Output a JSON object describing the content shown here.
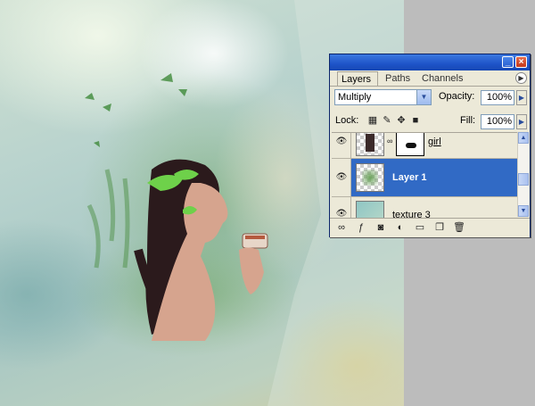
{
  "palette": {
    "tabs": [
      {
        "label": "Layers",
        "active": true
      },
      {
        "label": "Paths",
        "active": false
      },
      {
        "label": "Channels",
        "active": false
      }
    ],
    "blend_mode": "Multiply",
    "opacity_label": "Opacity:",
    "opacity_value": "100%",
    "lock_label": "Lock:",
    "fill_label": "Fill:",
    "fill_value": "100%",
    "layers": [
      {
        "name": "girl",
        "visible": true,
        "selected": false,
        "has_mask": true
      },
      {
        "name": "Layer 1",
        "visible": true,
        "selected": true,
        "has_mask": false
      },
      {
        "name": "texture 3",
        "visible": true,
        "selected": false,
        "has_mask": false
      }
    ],
    "colors": {
      "titlebar": "#1e54c8",
      "selection": "#316ac5",
      "panel_bg": "#ece9d8"
    },
    "icons": [
      "minimize-icon",
      "close-icon",
      "palette-menu-icon",
      "eye-icon",
      "link-icon",
      "lock-transparency-icon",
      "lock-brush-icon",
      "lock-move-icon",
      "lock-all-icon",
      "layer-style-icon",
      "add-mask-icon",
      "adjustment-layer-icon",
      "new-group-icon",
      "new-layer-icon",
      "trash-icon"
    ]
  }
}
